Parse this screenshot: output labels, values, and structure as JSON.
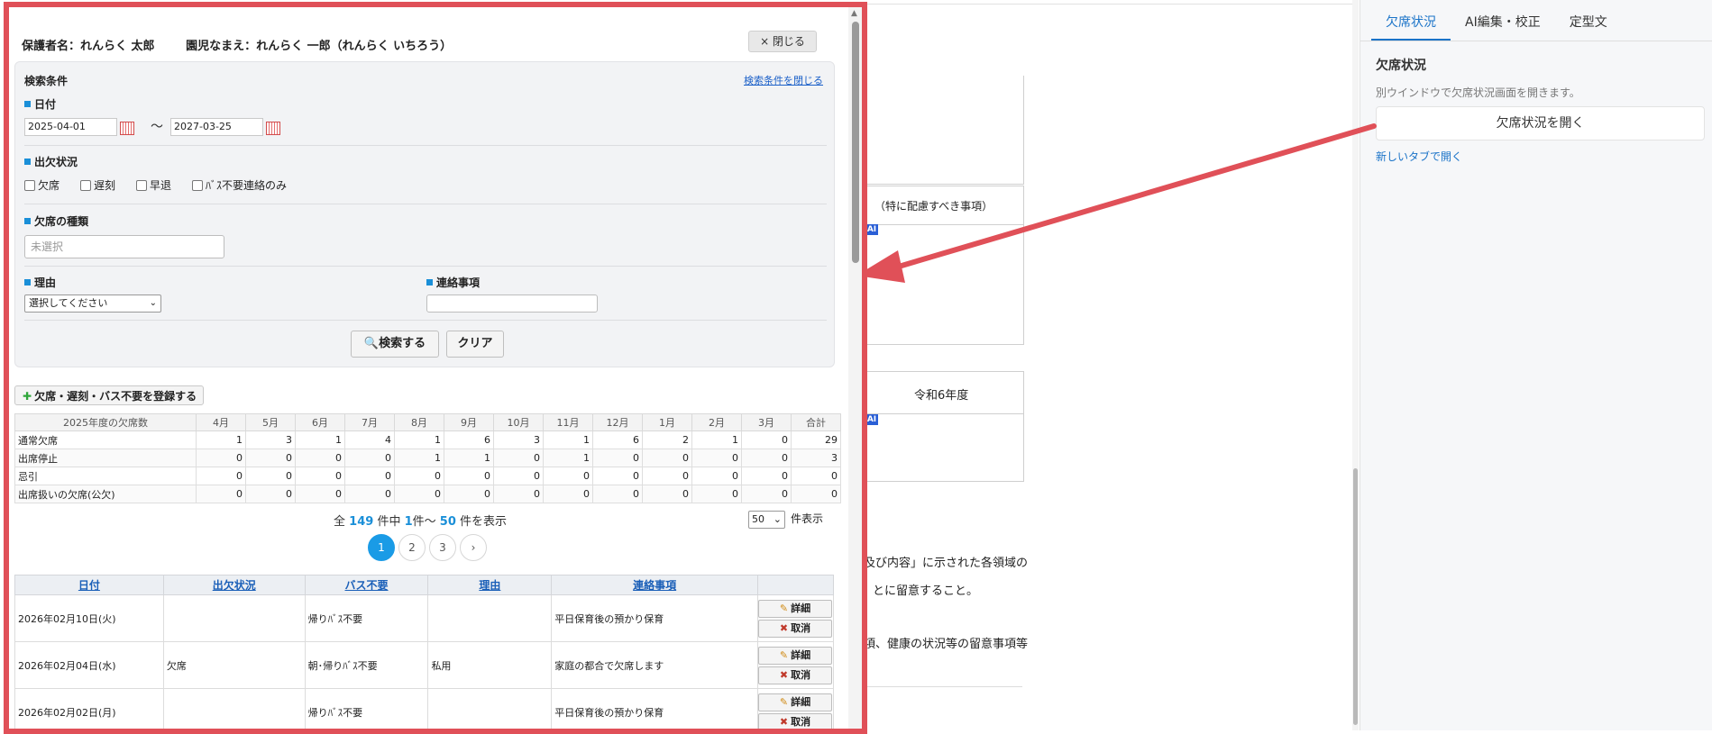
{
  "background": {
    "note_cell": "（特に配慮すべき事項）",
    "year_cell": "令和6年度",
    "ai_badge": "AI",
    "para1": "及び内容」に示された各領域の",
    "para2": "とに留意すること。",
    "para3": "項、健康の状況等の留意事項等"
  },
  "side": {
    "tabs": [
      "欠席状況",
      "AI編集・校正",
      "定型文"
    ],
    "title": "欠席状況",
    "description": "別ウインドウで欠席状況画面を開きます。",
    "open_button": "欠席状況を開く",
    "new_tab_link": "新しいタブで開く",
    "accent": "#1a73c8"
  },
  "modal": {
    "guardian": "保護者名：れんらく 太郎",
    "child": "園児なまえ：れんらく 一郎（れんらく いちろう）",
    "close_button": "× 閉じる",
    "border_color": "#e05058",
    "search": {
      "title": "検索条件",
      "close_link": "検索条件を閉じる",
      "date_label": "日付",
      "date_from": "2025-04-01",
      "tilde": "～",
      "date_to": "2027-03-25",
      "attendance_label": "出欠状況",
      "checkboxes": [
        "欠席",
        "遅刻",
        "早退",
        "ﾊﾞｽ不要連絡のみ"
      ],
      "absence_type_label": "欠席の種類",
      "absence_type_placeholder": "未選択",
      "reason_label": "理由",
      "reason_select": "選択してください",
      "contact_label": "連絡事項",
      "search_button": "検索する",
      "clear_button": "クリア"
    },
    "register_button": "欠席・遅刻・バス不要を登録する",
    "counts_table": {
      "headers": [
        "2025年度の欠席数",
        "4月",
        "5月",
        "6月",
        "7月",
        "8月",
        "9月",
        "10月",
        "11月",
        "12月",
        "1月",
        "2月",
        "3月",
        "合計"
      ],
      "rows": [
        [
          "通常欠席",
          "1",
          "3",
          "1",
          "4",
          "1",
          "6",
          "3",
          "1",
          "6",
          "2",
          "1",
          "0",
          "29"
        ],
        [
          "出席停止",
          "0",
          "0",
          "0",
          "0",
          "1",
          "1",
          "0",
          "1",
          "0",
          "0",
          "0",
          "0",
          "3"
        ],
        [
          "忌引",
          "0",
          "0",
          "0",
          "0",
          "0",
          "0",
          "0",
          "0",
          "0",
          "0",
          "0",
          "0",
          "0"
        ],
        [
          "出席扱いの欠席(公欠)",
          "0",
          "0",
          "0",
          "0",
          "0",
          "0",
          "0",
          "0",
          "0",
          "0",
          "0",
          "0",
          "0"
        ]
      ]
    },
    "pager": {
      "prefix": "全",
      "total": "149",
      "mid1": "件中",
      "from": "1",
      "mid2": "件～",
      "to": "50",
      "suffix": "件を表示",
      "per_page": "50",
      "per_page_suffix": "件表示",
      "pages": [
        "1",
        "2",
        "3",
        "›"
      ]
    },
    "list": {
      "headers": [
        "日付",
        "出欠状況",
        "バス不要",
        "理由",
        "連絡事項"
      ],
      "detail_button": "詳細",
      "cancel_button": "取消",
      "rows": [
        {
          "date": "2026年02月10日(火)",
          "status": "",
          "bus": "帰りﾊﾞｽ不要",
          "reason": "",
          "note": "平日保育後の預かり保育"
        },
        {
          "date": "2026年02月04日(水)",
          "status": "欠席",
          "bus": "朝･帰りﾊﾞｽ不要",
          "reason": "私用",
          "note": "家庭の都合で欠席します"
        },
        {
          "date": "2026年02月02日(月)",
          "status": "",
          "bus": "帰りﾊﾞｽ不要",
          "reason": "",
          "note": "平日保育後の預かり保育"
        }
      ]
    }
  }
}
